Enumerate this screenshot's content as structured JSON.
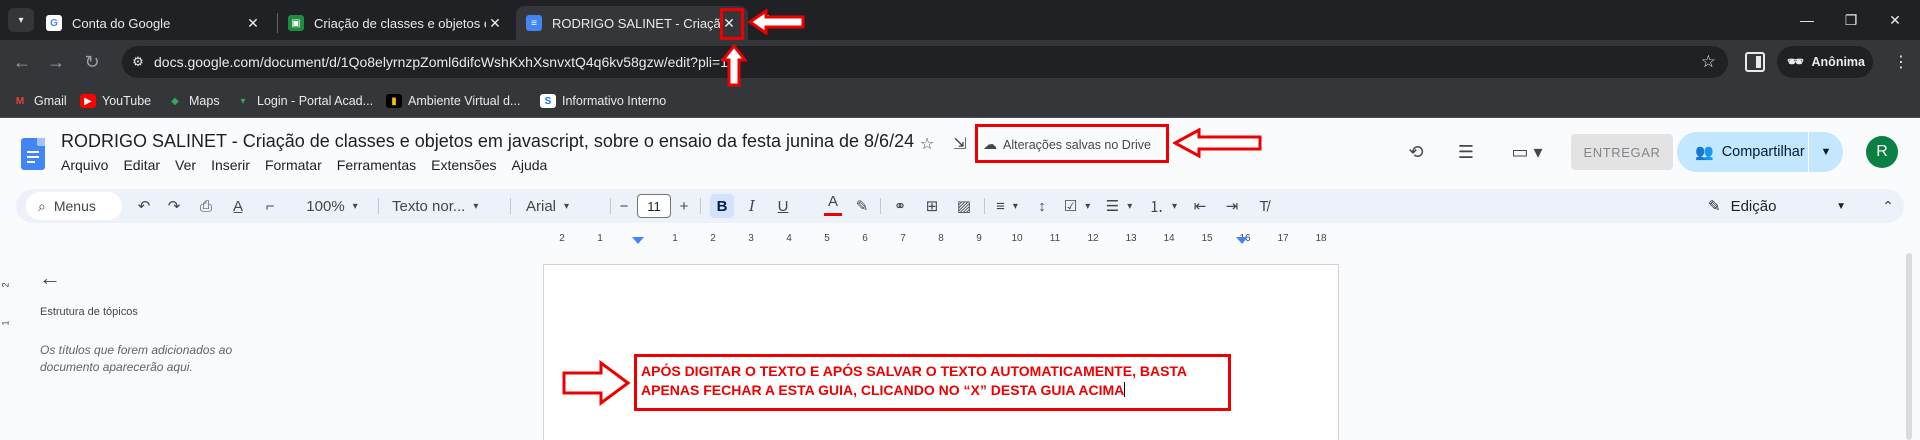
{
  "browser": {
    "tabs": [
      {
        "title": "Conta do Google",
        "active": false,
        "favicon": "google-g-icon"
      },
      {
        "title": "Criação de classes e objetos em",
        "active": false,
        "favicon": "classroom-icon"
      },
      {
        "title": "RODRIGO SALINET - Criação d",
        "active": true,
        "favicon": "docs-icon"
      }
    ],
    "url": "docs.google.com/document/d/1Qo8elyrnzpZoml6difcWshKxhXsnvxtQ4q6kv58gzw/edit?pli=1",
    "profile_label": "Anônima",
    "bookmarks": [
      {
        "label": "Gmail",
        "icon": "gmail-icon"
      },
      {
        "label": "YouTube",
        "icon": "youtube-icon"
      },
      {
        "label": "Maps",
        "icon": "maps-icon"
      },
      {
        "label": "Login - Portal Acad...",
        "icon": "portal-icon"
      },
      {
        "label": "Ambiente Virtual d...",
        "icon": "ava-icon"
      },
      {
        "label": "Informativo Interno",
        "icon": "informativo-icon"
      }
    ]
  },
  "docs": {
    "title": "RODRIGO SALINET - Criação de classes e objetos em javascript, sobre o ensaio da festa junina de 8/6/24",
    "save_status": "Alterações salvas no Drive",
    "menu": [
      "Arquivo",
      "Editar",
      "Ver",
      "Inserir",
      "Formatar",
      "Ferramentas",
      "Extensões",
      "Ajuda"
    ],
    "entregar_label": "ENTREGAR",
    "share_label": "Compartilhar",
    "avatar_letter": "R"
  },
  "toolbar": {
    "search_label": "Menus",
    "zoom": "100%",
    "style": "Texto nor...",
    "font": "Arial",
    "font_size": "11",
    "mode": "Edição"
  },
  "ruler": {
    "h_labels": [
      "2",
      "1",
      "1",
      "2",
      "3",
      "4",
      "5",
      "6",
      "7",
      "8",
      "9",
      "10",
      "11",
      "12",
      "13",
      "14",
      "15",
      "16",
      "17",
      "18"
    ],
    "v_labels": [
      "2",
      "1"
    ]
  },
  "outline": {
    "title": "Estrutura de tópicos",
    "empty_text": "Os títulos que forem adicionados ao documento aparecerão aqui."
  },
  "document": {
    "body_lines": [
      "APÓS DIGITAR O TEXTO E APÓS SALVAR O TEXTO AUTOMATICAMENTE, BASTA",
      "APENAS FECHAR A ESTA GUIA, CLICANDO NO “X” DESTA GUIA ACIMA"
    ]
  },
  "colors": {
    "annotation_red": "#e00000",
    "docs_blue": "#4285f4",
    "share_bg": "#c2e7ff"
  }
}
